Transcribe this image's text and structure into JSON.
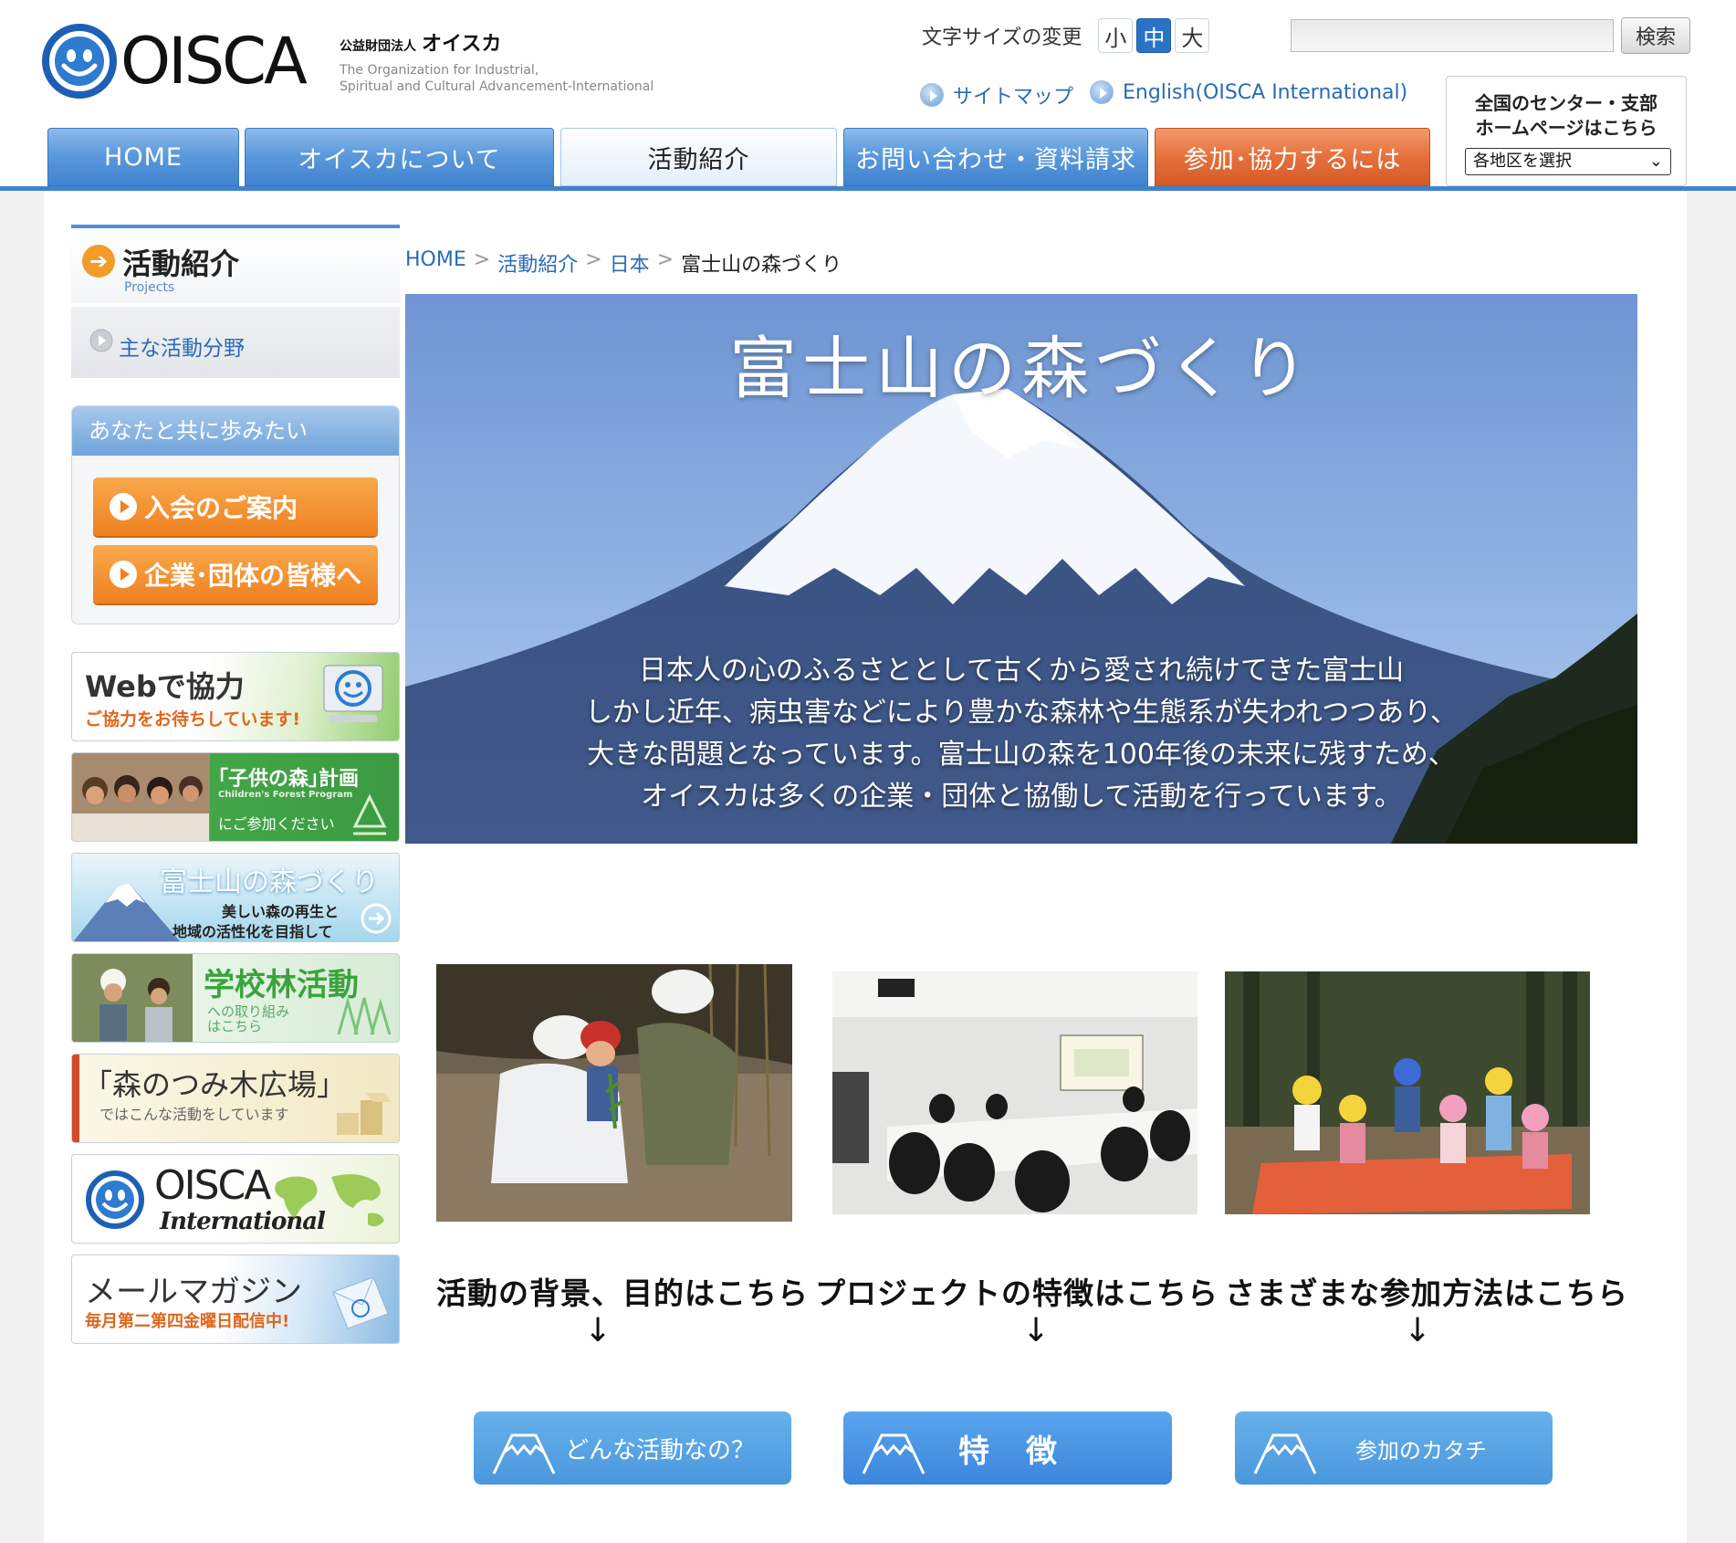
{
  "header": {
    "logo_text": "OISCA",
    "org_prefix": "公益財団法人",
    "org_kana": "オイスカ",
    "org_english_line1": "The Organization for Industrial,",
    "org_english_line2": "Spiritual and Cultural Advancement-International",
    "font_size_label": "文字サイズの変更",
    "font_sizes": [
      "小",
      "中",
      "大"
    ],
    "font_size_selected": "中",
    "search_button": "検索",
    "search_placeholder": "",
    "sitemap_link": "サイトマップ",
    "english_link": "English(OISCA International)",
    "branch_title": "全国のセンター・支部\nホームページはこちら",
    "branch_select_value": "各地区を選択"
  },
  "nav": {
    "home": "HOME",
    "about": "オイスカについて",
    "activities": "活動紹介",
    "contact": "お問い合わせ・資料請求",
    "join": "参加･協力するには"
  },
  "sidebar": {
    "section_title": "活動紹介",
    "section_subtitle": "Projects",
    "menu_item": "主な活動分野",
    "walk_box_title": "あなたと共に歩みたい",
    "membership_button": "入会のご案内",
    "corporate_button": "企業･団体の皆様へ",
    "banners": {
      "web": {
        "title": "Webで協力",
        "sub": "ご協力をお待ちしています!"
      },
      "kids": {
        "title": "｢子供の森｣計画",
        "en": "Children's Forest Program",
        "sub": "にご参加ください"
      },
      "fuji": {
        "title": "富士山の森づくり",
        "sub1": "美しい森の再生と",
        "sub2": "地域の活性化を目指して"
      },
      "school": {
        "title": "学校林活動",
        "sub1": "への取り組み",
        "sub2": "はこちら"
      },
      "tsumiki": {
        "title": "「森のつみ木広場」",
        "sub": "ではこんな活動をしています"
      },
      "intl": {
        "title": "OISCA",
        "sub": "International"
      },
      "mail": {
        "title": "メールマガジン",
        "sub": "毎月第二第四金曜日配信中!"
      }
    }
  },
  "breadcrumb": {
    "home": "HOME",
    "activities": "活動紹介",
    "japan": "日本",
    "current": "富士山の森づくり",
    "separator": ">"
  },
  "hero": {
    "title": "富士山の森づくり",
    "lines": [
      "日本人の心のふるさととして古くから愛され続けてきた富士山",
      "しかし近年、病虫害などにより豊かな森林や生態系が失われつつあり、",
      "大きな問題となっています。富士山の森を100年後の未来に残すため、",
      "オイスカは多くの企業・団体と協働して活動を行っています。"
    ]
  },
  "columns": {
    "background_heading": "活動の背景、目的はこちら",
    "features_heading": "プロジェクトの特徴はこちら",
    "participate_heading": "さまざまな参加方法はこちら",
    "arrow": "↓",
    "what_button": "どんな活動なの？",
    "features_button": "特徴",
    "how_button": "参加のカタチ"
  },
  "colors": {
    "nav_blue": "#3f82cf",
    "nav_orange": "#e5703c",
    "link_blue": "#2a6bb6",
    "button_orange": "#ef8020",
    "button_blue": "#4a97dd"
  }
}
